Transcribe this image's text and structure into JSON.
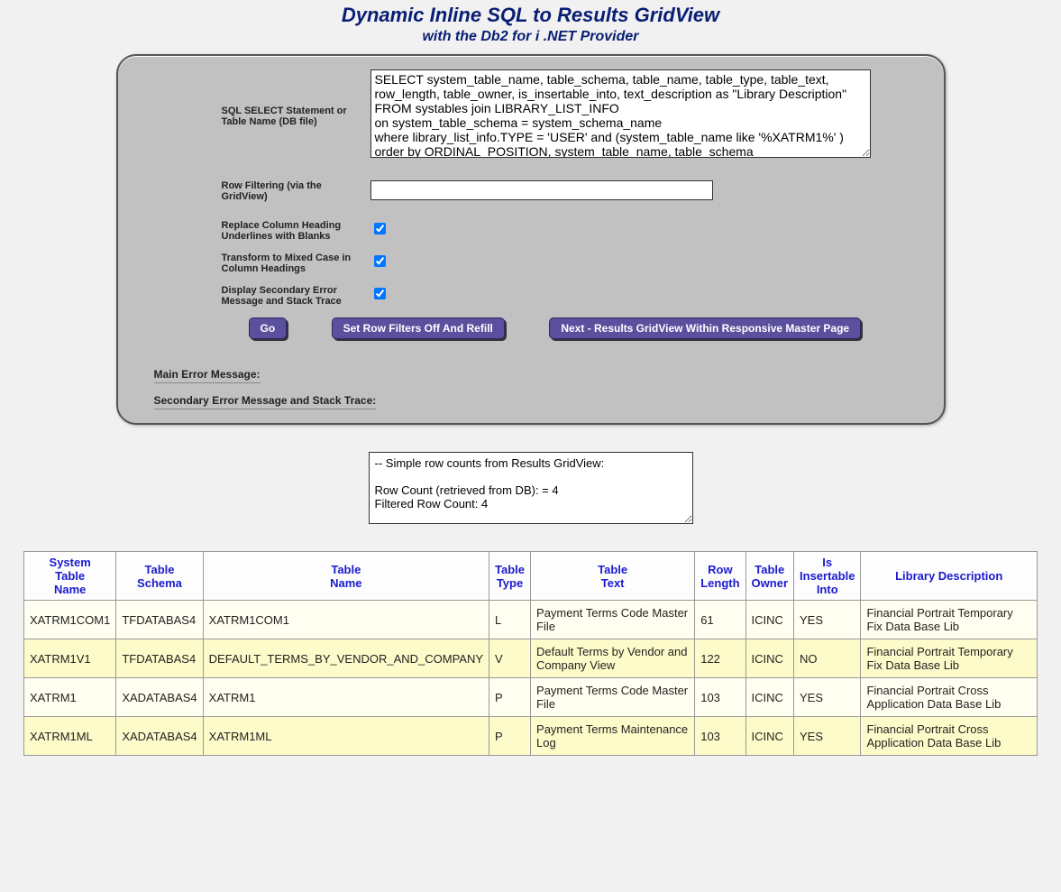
{
  "title": "Dynamic Inline SQL to Results GridView",
  "subtitle": "with the Db2 for i .NET Provider",
  "form": {
    "sql_label": "SQL SELECT Statement or Table Name (DB file)",
    "sql_value": "SELECT system_table_name, table_schema, table_name, table_type, table_text, row_length, table_owner, is_insertable_into, text_description as \"Library Description\"\nFROM systables join LIBRARY_LIST_INFO\non system_table_schema = system_schema_name\nwhere library_list_info.TYPE = 'USER' and (system_table_name like '%XATRM1%' )\norder by ORDINAL_POSITION, system_table_name, table_schema",
    "row_filter_label": "Row Filtering (via the GridView)",
    "row_filter_value": "",
    "chk_replace_label": "Replace Column Heading Underlines with Blanks",
    "chk_mixed_label": "Transform to Mixed Case in Column Headings",
    "chk_stack_label": "Display Secondary Error Message and Stack Trace",
    "go_label": "Go",
    "set_filters_label": "Set Row Filters Off And Refill",
    "next_label": "Next - Results GridView Within Responsive Master Page",
    "main_err_label": "Main Error Message:",
    "secondary_err_label": "Secondary Error Message and Stack Trace:"
  },
  "row_info": "-- Simple row counts from Results GridView:\n\nRow Count (retrieved from DB): = 4\nFiltered Row Count: 4",
  "grid": {
    "columns": [
      "System\nTable\nName",
      "Table\nSchema",
      "Table\nName",
      "Table\nType",
      "Table\nText",
      "Row\nLength",
      "Table\nOwner",
      "Is\nInsertable\nInto",
      "Library Description"
    ],
    "rows": [
      {
        "system_table_name": "XATRM1COM1",
        "table_schema": "TFDATABAS4",
        "table_name": "XATRM1COM1",
        "table_type": "L",
        "table_text": "Payment Terms Code Master File",
        "row_length": "61",
        "table_owner": "ICINC",
        "is_insertable_into": "YES",
        "library_description": "Financial Portrait Temporary Fix Data Base Lib"
      },
      {
        "system_table_name": "XATRM1V1",
        "table_schema": "TFDATABAS4",
        "table_name": "DEFAULT_TERMS_BY_VENDOR_AND_COMPANY",
        "table_type": "V",
        "table_text": "Default Terms by Vendor and Company View",
        "row_length": "122",
        "table_owner": "ICINC",
        "is_insertable_into": "NO",
        "library_description": "Financial Portrait Temporary Fix Data Base Lib"
      },
      {
        "system_table_name": "XATRM1",
        "table_schema": "XADATABAS4",
        "table_name": "XATRM1",
        "table_type": "P",
        "table_text": "Payment Terms Code Master File",
        "row_length": "103",
        "table_owner": "ICINC",
        "is_insertable_into": "YES",
        "library_description": "Financial Portrait Cross Application Data Base Lib"
      },
      {
        "system_table_name": "XATRM1ML",
        "table_schema": "XADATABAS4",
        "table_name": "XATRM1ML",
        "table_type": "P",
        "table_text": "Payment Terms Maintenance Log",
        "row_length": "103",
        "table_owner": "ICINC",
        "is_insertable_into": "YES",
        "library_description": "Financial Portrait Cross Application Data Base Lib"
      }
    ]
  }
}
